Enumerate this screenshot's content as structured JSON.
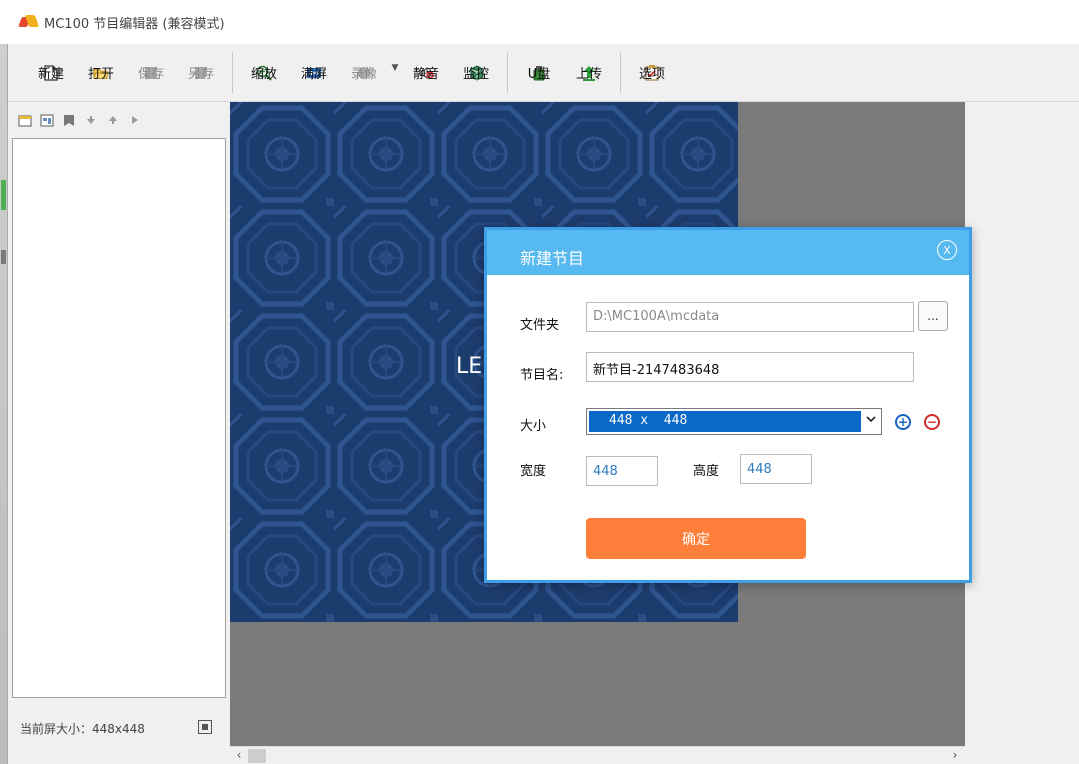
{
  "window": {
    "title": "MC100 节目编辑器 (兼容模式)"
  },
  "toolbar": {
    "new": "新建",
    "open": "打开",
    "save": "保存",
    "save_as": "另存",
    "zoom": "缩放",
    "fullscreen": "满屏",
    "record": "录像",
    "mute": "静音",
    "monitor": "监控",
    "usb": "U盘",
    "upload": "上传",
    "options": "选项"
  },
  "left_panel": {
    "status": "当前屏大小：448x448"
  },
  "screen": {
    "text": "LE"
  },
  "dialog": {
    "title": "新建节目",
    "close": "X",
    "folder_label": "文件夹",
    "folder_value": "D:\\MC100A\\mcdata",
    "browse": "...",
    "name_label": "节目名:",
    "name_value": "新节目-2147483648",
    "size_label": "大小",
    "size_value": "448 x  448",
    "width_label": "宽度",
    "width_value": "448",
    "height_label": "高度",
    "height_value": "448",
    "ok": "确定"
  },
  "colors": {
    "dialog_header": "#56b9f0",
    "dialog_border": "#3e9fe6",
    "ok_button": "#ff7f3a",
    "select_highlight": "#0a68c9",
    "screen_bg": "#1d3c6e"
  }
}
